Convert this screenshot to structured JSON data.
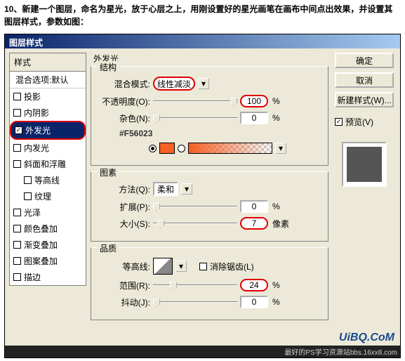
{
  "instruction": "10、新建一个图层，命名为星光，放于心层之上，用刚设置好的星光画笔在画布中间点出效果，并设置其图层样式，参数如图：",
  "dialog": {
    "title": "图层样式"
  },
  "styles": {
    "header": "样式",
    "blend_options": "混合选项:默认",
    "items": [
      "投影",
      "内阴影",
      "外发光",
      "内发光",
      "斜面和浮雕",
      "等高线",
      "纹理",
      "光泽",
      "颜色叠加",
      "渐变叠加",
      "图案叠加",
      "描边"
    ],
    "selected_index": 2
  },
  "outer_glow": {
    "title": "外发光",
    "structure": {
      "label": "结构",
      "blend_mode_label": "混合模式:",
      "blend_mode_value": "线性减淡",
      "opacity_label": "不透明度(O):",
      "opacity_value": "100",
      "opacity_unit": "%",
      "noise_label": "杂色(N):",
      "noise_value": "0",
      "noise_unit": "%",
      "color_hex": "#F56023"
    },
    "elements": {
      "label": "图素",
      "technique_label": "方法(Q):",
      "technique_value": "柔和",
      "spread_label": "扩展(P):",
      "spread_value": "0",
      "spread_unit": "%",
      "size_label": "大小(S):",
      "size_value": "7",
      "size_unit": "像素"
    },
    "quality": {
      "label": "品质",
      "contour_label": "等高线:",
      "antialias_label": "消除锯齿(L)",
      "range_label": "范围(R):",
      "range_value": "24",
      "range_unit": "%",
      "jitter_label": "抖动(J):",
      "jitter_value": "0",
      "jitter_unit": "%"
    }
  },
  "buttons": {
    "ok": "确定",
    "cancel": "取消",
    "new_style": "新建样式(W)...",
    "preview": "预览(V)"
  },
  "watermark": "UiBQ.CoM",
  "footer": "最好的PS学习资源站bbs.16xx8.com"
}
